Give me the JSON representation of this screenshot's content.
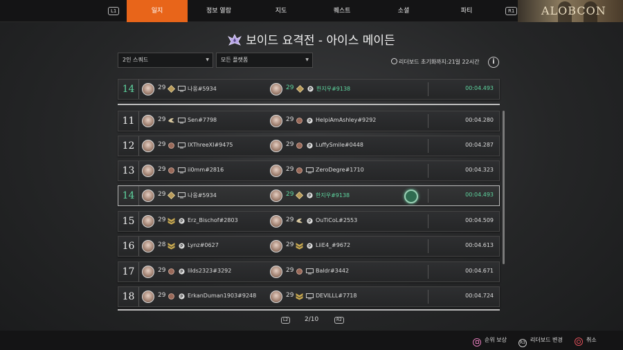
{
  "topnav": {
    "l1": "L1",
    "r1": "R1",
    "tabs": [
      {
        "label": "일지",
        "active": true
      },
      {
        "label": "정보 열람",
        "active": false
      },
      {
        "label": "지도",
        "active": false
      },
      {
        "label": "퀘스트",
        "active": false
      },
      {
        "label": "소셜",
        "active": false
      },
      {
        "label": "파티",
        "active": false
      }
    ],
    "banner_text": "ALOBCON"
  },
  "title": "보이드 요격전 - 아이스 메이든",
  "filters": {
    "squad": "2인 스쿼드",
    "platform": "모든 플랫폼"
  },
  "reset_text": "리더보드 초기화까지:21일 22시간",
  "accent_color": "#e8651a",
  "me_color": "#5fd6a0",
  "my_row": {
    "rank": "14",
    "p1": {
      "level": "29",
      "name": "나옹#5934",
      "badge": "diamond-badge-icon",
      "platform": "pc-icon"
    },
    "p2": {
      "level": "29",
      "name": "한지우#9138",
      "badge": "diamond-badge-icon",
      "platform": "playstation-icon"
    },
    "time": "00:04.493"
  },
  "rows": [
    {
      "rank": "11",
      "me": false,
      "p1": {
        "level": "29",
        "name": "Sen#7798",
        "badge": "bird-badge-icon",
        "platform": "pc-icon"
      },
      "p2": {
        "level": "29",
        "name": "HelpiAmAshley#9292",
        "badge": "round-badge-icon",
        "platform": "playstation-icon"
      },
      "time": "00:04.280"
    },
    {
      "rank": "12",
      "me": false,
      "p1": {
        "level": "29",
        "name": "IXThreeXI#9475",
        "badge": "round-badge-icon",
        "platform": "pc-icon"
      },
      "p2": {
        "level": "29",
        "name": "LuffySmile#0448",
        "badge": "round-badge-icon",
        "platform": "playstation-icon"
      },
      "time": "00:04.287"
    },
    {
      "rank": "13",
      "me": false,
      "p1": {
        "level": "29",
        "name": "ii0mm#2816",
        "badge": "round-badge-icon",
        "platform": "pc-icon"
      },
      "p2": {
        "level": "29",
        "name": "ZeroDegre#1710",
        "badge": "round-badge-icon",
        "platform": "pc-icon"
      },
      "time": "00:04.323"
    },
    {
      "rank": "14",
      "me": true,
      "p1": {
        "level": "29",
        "name": "나옹#5934",
        "badge": "diamond-badge-icon",
        "platform": "pc-icon"
      },
      "p2": {
        "level": "29",
        "name": "한지우#9138",
        "badge": "diamond-badge-icon",
        "platform": "playstation-icon"
      },
      "time": "00:04.493"
    },
    {
      "rank": "15",
      "me": false,
      "p1": {
        "level": "29",
        "name": "Erz_Bischof#2803",
        "badge": "chevron-badge-icon",
        "platform": "playstation-icon"
      },
      "p2": {
        "level": "29",
        "name": "OuTiCoL#2553",
        "badge": "bird-badge-icon",
        "platform": "playstation-icon"
      },
      "time": "00:04.509"
    },
    {
      "rank": "16",
      "me": false,
      "p1": {
        "level": "28",
        "name": "Lynz#0627",
        "badge": "chevron-badge-icon",
        "platform": "playstation-icon"
      },
      "p2": {
        "level": "29",
        "name": "LiiE4_#9672",
        "badge": "chevron-badge-icon",
        "platform": "playstation-icon"
      },
      "time": "00:04.613"
    },
    {
      "rank": "17",
      "me": false,
      "p1": {
        "level": "29",
        "name": "lilds2323#3292",
        "badge": "round-badge-icon",
        "platform": "playstation-icon"
      },
      "p2": {
        "level": "29",
        "name": "Baldr#3442",
        "badge": "round-badge-icon",
        "platform": "pc-icon"
      },
      "time": "00:04.671"
    },
    {
      "rank": "18",
      "me": false,
      "p1": {
        "level": "29",
        "name": "ErkanDuman1903#9248",
        "badge": "round-badge-icon",
        "platform": "playstation-icon"
      },
      "p2": {
        "level": "29",
        "name": "DEVILLL#7718",
        "badge": "chevron-badge-icon",
        "platform": "pc-icon"
      },
      "time": "00:04.724"
    }
  ],
  "pager": {
    "l2": "L2",
    "r2": "R2",
    "text": "2/10"
  },
  "controls": [
    {
      "label": "순위 보상",
      "icon": "square-button-icon"
    },
    {
      "label": "리더보드 변경",
      "icon": "r3-button-icon",
      "icon_text": "R3"
    },
    {
      "label": "취소",
      "icon": "circle-button-icon"
    }
  ]
}
